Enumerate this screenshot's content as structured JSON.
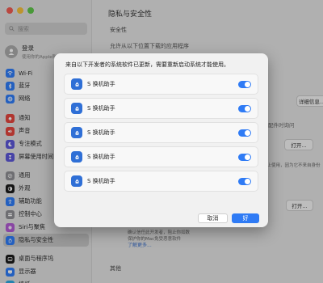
{
  "sidebar": {
    "search_placeholder": "搜索",
    "account": {
      "name": "登录",
      "subtitle": "使用你的Apple账户"
    },
    "groups": [
      [
        {
          "label": "Wi-Fi",
          "icon": "wifi-icon",
          "color": "#2f7bf5"
        },
        {
          "label": "蓝牙",
          "icon": "bluetooth-icon",
          "color": "#2f7bf5"
        },
        {
          "label": "网络",
          "icon": "globe-icon",
          "color": "#2f7bf5"
        }
      ],
      [
        {
          "label": "通知",
          "icon": "bell-icon",
          "color": "#e2463e"
        },
        {
          "label": "声音",
          "icon": "speaker-icon",
          "color": "#e2463e"
        },
        {
          "label": "专注模式",
          "icon": "moon-icon",
          "color": "#5b56d6"
        },
        {
          "label": "屏幕使用时间",
          "icon": "hourglass-icon",
          "color": "#5b56d6"
        }
      ],
      [
        {
          "label": "通用",
          "icon": "gear-icon",
          "color": "#8e8e93"
        },
        {
          "label": "外观",
          "icon": "appearance-icon",
          "color": "#1c1c1c"
        },
        {
          "label": "辅助功能",
          "icon": "accessibility-icon",
          "color": "#2f7bf5"
        },
        {
          "label": "控制中心",
          "icon": "control-center-icon",
          "color": "#8e8e93"
        },
        {
          "label": "Siri与聚焦",
          "icon": "siri-icon",
          "color": "#b05ad1"
        },
        {
          "label": "隐私与安全性",
          "icon": "hand-icon",
          "color": "#2f7bf5"
        }
      ],
      [
        {
          "label": "桌面与程序坞",
          "icon": "dock-icon",
          "color": "#1c1c1c"
        },
        {
          "label": "显示器",
          "icon": "display-icon",
          "color": "#2f7bf5"
        },
        {
          "label": "墙纸",
          "icon": "wallpaper-icon",
          "color": "#2fa7e0"
        }
      ]
    ]
  },
  "main": {
    "title": "隐私与安全性",
    "section_title": "安全性",
    "allow_apps_label": "允许从以下位置下载的应用程序",
    "details_button": "详细信息...",
    "accessory_label": "配件时询问",
    "open_button_1": "打开...",
    "open_button_2": "打开...",
    "note_1": "路被阻止使用，因为它不来自身份",
    "note_2": "确认信任此开发者，阻止你如数",
    "note_3": "保护你的Mac免受恶意软件",
    "learn_more": "了解更多...",
    "other_title": "其他"
  },
  "dialog": {
    "message": "来自以下开发者的系统软件已更新，需要重新启动系统才能使用。",
    "items": [
      {
        "label": "S 换机助手",
        "enabled": true
      },
      {
        "label": "S 换机助手",
        "enabled": true
      },
      {
        "label": "S 换机助手",
        "enabled": true
      },
      {
        "label": "S 换机助手",
        "enabled": true
      },
      {
        "label": "S 换机助手",
        "enabled": true
      }
    ],
    "cancel": "取消",
    "ok": "好"
  },
  "colors": {
    "accent": "#2f7bf5",
    "app_icon": "#2f6fd6"
  }
}
